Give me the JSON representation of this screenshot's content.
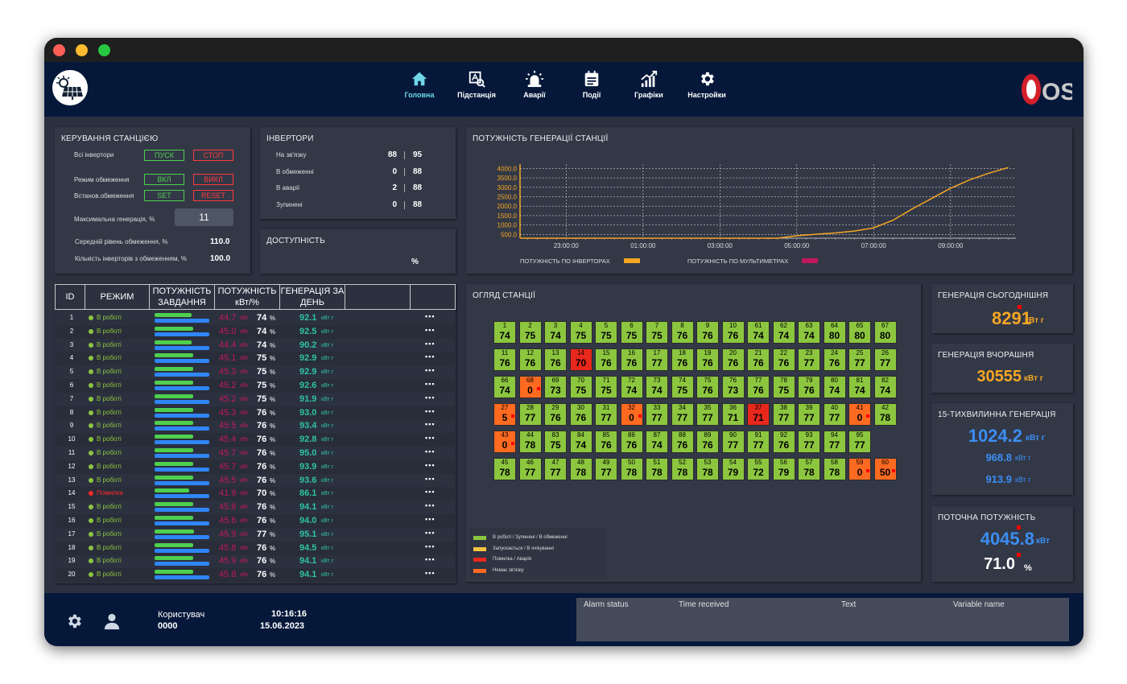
{
  "nav": [
    {
      "label": "Головна",
      "icon": "home-icon",
      "active": true
    },
    {
      "label": "Підстанція",
      "icon": "substation-icon",
      "active": false
    },
    {
      "label": "Аварії",
      "icon": "alarm-icon",
      "active": false
    },
    {
      "label": "Події",
      "icon": "events-icon",
      "active": false
    },
    {
      "label": "Графіки",
      "icon": "charts-icon",
      "active": false
    },
    {
      "label": "Настройки",
      "icon": "settings-icon",
      "active": false
    }
  ],
  "brand": "OSS",
  "control": {
    "title": "КЕРУВАННЯ СТАНЦІЄЮ",
    "all_inverters": "Всі інвертори",
    "start": "ПУСК",
    "stop": "СТОП",
    "limit_mode": "Режим обмеження",
    "on": "ВКЛ",
    "off": "ВИКЛ",
    "set_limit": "Встанов.обмеження",
    "set": "SET",
    "reset": "RESET",
    "max_gen": "Максимальна генерація, %",
    "max_gen_value": "11",
    "avg_limit": "Середній рівень обмеження, %",
    "avg_limit_value": "110.0",
    "count_limited": "Кількість інверторів з обмеженням, %",
    "count_limited_value": "100.0"
  },
  "inverters": {
    "title": "ІНВЕРТОРИ",
    "rows": [
      {
        "label": "На зв'язку",
        "a": "88",
        "b": "95"
      },
      {
        "label": "В обмеженні",
        "a": "0",
        "b": "88"
      },
      {
        "label": "В аварії",
        "a": "2",
        "b": "88"
      },
      {
        "label": "Зупинені",
        "a": "0",
        "b": "88"
      }
    ]
  },
  "availability": {
    "title": "ДОСТУПНІСТЬ",
    "unit": "%"
  },
  "chart_data": {
    "type": "line",
    "title": "ПОТУЖНІСТЬ ГЕНЕРАЦІЇ СТАНЦІЇ",
    "y_ticks": [
      "4000.0",
      "3500.0",
      "3000.0",
      "2500.0",
      "2000.0",
      "1500.0",
      "1000.0",
      "500.0"
    ],
    "x_ticks": [
      "23:00:00",
      "01:00:00",
      "03:00:00",
      "05:00:00",
      "07:00:00",
      "09:00:00"
    ],
    "ylim": [
      300,
      4100
    ],
    "x_hours": [
      21.8,
      22.5,
      23.5,
      24.5,
      25.5,
      26.5,
      27.5,
      28.5,
      29,
      29.5,
      30,
      30.5,
      31,
      31.5,
      32,
      32.5,
      33,
      33.5,
      34,
      34.5
    ],
    "series": [
      {
        "name": "ПОТУЖНІСТЬ ПО ІНВЕРТОРАХ",
        "color": "#f5a623",
        "values": [
          0,
          0,
          0,
          0,
          0,
          0,
          0,
          0,
          430,
          510,
          580,
          680,
          850,
          1250,
          1850,
          2400,
          2950,
          3400,
          3750,
          4050
        ]
      },
      {
        "name": "ПОТУЖНІСТЬ ПО МУЛЬТИМЕТРАХ",
        "color": "#c2185b",
        "values": []
      }
    ],
    "grid": true,
    "legend": "bottom"
  },
  "table": {
    "headers": [
      "ID",
      "РЕЖИМ",
      "ПОТУЖНІСТЬ ЗАВДАННЯ",
      "ПОТУЖНІСТЬ кВт/%",
      "ГЕНЕРАЦІЯ ЗА ДЕНЬ"
    ],
    "unit_kw": "кВт",
    "unit_pct": "%",
    "unit_kwh": "кВт г",
    "more": "▪▪▪",
    "rows": [
      {
        "id": "1",
        "status": "В роботі",
        "ok": true,
        "kw": "44.7",
        "pct": "74",
        "gen": "92.1",
        "bar_green": 0.68,
        "bar_blue": 1.0
      },
      {
        "id": "2",
        "status": "В роботі",
        "ok": true,
        "kw": "45.0",
        "pct": "74",
        "gen": "92.5",
        "bar_green": 0.7,
        "bar_blue": 1.0
      },
      {
        "id": "3",
        "status": "В роботі",
        "ok": true,
        "kw": "44.4",
        "pct": "74",
        "gen": "90.2",
        "bar_green": 0.68,
        "bar_blue": 1.0
      },
      {
        "id": "4",
        "status": "В роботі",
        "ok": true,
        "kw": "45.1",
        "pct": "75",
        "gen": "92.9",
        "bar_green": 0.7,
        "bar_blue": 1.0
      },
      {
        "id": "5",
        "status": "В роботі",
        "ok": true,
        "kw": "45.3",
        "pct": "75",
        "gen": "92.9",
        "bar_green": 0.7,
        "bar_blue": 1.0
      },
      {
        "id": "6",
        "status": "В роботі",
        "ok": true,
        "kw": "45.2",
        "pct": "75",
        "gen": "92.6",
        "bar_green": 0.7,
        "bar_blue": 1.0
      },
      {
        "id": "7",
        "status": "В роботі",
        "ok": true,
        "kw": "45.2",
        "pct": "75",
        "gen": "91.9",
        "bar_green": 0.7,
        "bar_blue": 1.0
      },
      {
        "id": "8",
        "status": "В роботі",
        "ok": true,
        "kw": "45.3",
        "pct": "76",
        "gen": "93.0",
        "bar_green": 0.7,
        "bar_blue": 1.0
      },
      {
        "id": "9",
        "status": "В роботі",
        "ok": true,
        "kw": "45.5",
        "pct": "76",
        "gen": "93.4",
        "bar_green": 0.71,
        "bar_blue": 1.0
      },
      {
        "id": "10",
        "status": "В роботі",
        "ok": true,
        "kw": "45.4",
        "pct": "76",
        "gen": "92.8",
        "bar_green": 0.71,
        "bar_blue": 1.0
      },
      {
        "id": "11",
        "status": "В роботі",
        "ok": true,
        "kw": "45.7",
        "pct": "76",
        "gen": "95.0",
        "bar_green": 0.71,
        "bar_blue": 1.0
      },
      {
        "id": "12",
        "status": "В роботі",
        "ok": true,
        "kw": "45.7",
        "pct": "76",
        "gen": "93.9",
        "bar_green": 0.71,
        "bar_blue": 1.0
      },
      {
        "id": "13",
        "status": "В роботі",
        "ok": true,
        "kw": "45.5",
        "pct": "76",
        "gen": "93.6",
        "bar_green": 0.71,
        "bar_blue": 1.0
      },
      {
        "id": "14",
        "status": "Помилка",
        "ok": false,
        "kw": "41.9",
        "pct": "70",
        "gen": "86.1",
        "bar_green": 0.63,
        "bar_blue": 1.0
      },
      {
        "id": "15",
        "status": "В роботі",
        "ok": true,
        "kw": "45.8",
        "pct": "76",
        "gen": "94.1",
        "bar_green": 0.71,
        "bar_blue": 1.0
      },
      {
        "id": "16",
        "status": "В роботі",
        "ok": true,
        "kw": "45.6",
        "pct": "76",
        "gen": "94.0",
        "bar_green": 0.71,
        "bar_blue": 1.0
      },
      {
        "id": "17",
        "status": "В роботі",
        "ok": true,
        "kw": "45.9",
        "pct": "77",
        "gen": "95.1",
        "bar_green": 0.72,
        "bar_blue": 1.0
      },
      {
        "id": "18",
        "status": "В роботі",
        "ok": true,
        "kw": "45.8",
        "pct": "76",
        "gen": "94.5",
        "bar_green": 0.71,
        "bar_blue": 1.0
      },
      {
        "id": "19",
        "status": "В роботі",
        "ok": true,
        "kw": "45.9",
        "pct": "76",
        "gen": "94.1",
        "bar_green": 0.71,
        "bar_blue": 1.0
      },
      {
        "id": "20",
        "status": "В роботі",
        "ok": true,
        "kw": "45.8",
        "pct": "76",
        "gen": "94.1",
        "bar_green": 0.71,
        "bar_blue": 1.0
      }
    ]
  },
  "overview": {
    "title": "ОГЛЯД СТАНЦІЇ",
    "rows": [
      [
        {
          "n": "1",
          "v": "74"
        },
        {
          "n": "2",
          "v": "75"
        },
        {
          "n": "3",
          "v": "74"
        },
        {
          "n": "4",
          "v": "75"
        },
        {
          "n": "5",
          "v": "75"
        },
        {
          "n": "6",
          "v": "75"
        },
        {
          "n": "7",
          "v": "75"
        },
        {
          "n": "8",
          "v": "76"
        },
        {
          "n": "9",
          "v": "76"
        },
        {
          "n": "10",
          "v": "76"
        },
        {
          "n": "61",
          "v": "74"
        },
        {
          "n": "62",
          "v": "74"
        },
        {
          "n": "63",
          "v": "74"
        },
        {
          "n": "64",
          "v": "80"
        },
        {
          "n": "65",
          "v": "80"
        },
        {
          "n": "67",
          "v": "80"
        }
      ],
      [
        {
          "n": "11",
          "v": "76"
        },
        {
          "n": "12",
          "v": "76"
        },
        {
          "n": "13",
          "v": "76"
        },
        {
          "n": "14",
          "v": "70",
          "s": "f"
        },
        {
          "n": "15",
          "v": "76"
        },
        {
          "n": "16",
          "v": "76"
        },
        {
          "n": "17",
          "v": "77"
        },
        {
          "n": "18",
          "v": "76"
        },
        {
          "n": "19",
          "v": "76"
        },
        {
          "n": "20",
          "v": "76"
        },
        {
          "n": "21",
          "v": "76"
        },
        {
          "n": "22",
          "v": "76"
        },
        {
          "n": "23",
          "v": "77"
        },
        {
          "n": "24",
          "v": "76"
        },
        {
          "n": "25",
          "v": "77"
        },
        {
          "n": "26",
          "v": "77"
        }
      ],
      [
        {
          "n": "66",
          "v": "74"
        },
        {
          "n": "68",
          "v": "0",
          "s": "e"
        },
        {
          "n": "69",
          "v": "73"
        },
        {
          "n": "70",
          "v": "75"
        },
        {
          "n": "71",
          "v": "75"
        },
        {
          "n": "72",
          "v": "74"
        },
        {
          "n": "73",
          "v": "74"
        },
        {
          "n": "74",
          "v": "75"
        },
        {
          "n": "75",
          "v": "76"
        },
        {
          "n": "76",
          "v": "73"
        },
        {
          "n": "77",
          "v": "76"
        },
        {
          "n": "78",
          "v": "75"
        },
        {
          "n": "79",
          "v": "76"
        },
        {
          "n": "80",
          "v": "74"
        },
        {
          "n": "81",
          "v": "74"
        },
        {
          "n": "82",
          "v": "74"
        }
      ],
      [
        {
          "n": "27",
          "v": "5",
          "s": "e"
        },
        {
          "n": "28",
          "v": "77"
        },
        {
          "n": "29",
          "v": "76"
        },
        {
          "n": "30",
          "v": "76"
        },
        {
          "n": "31",
          "v": "77"
        },
        {
          "n": "32",
          "v": "0",
          "s": "e"
        },
        {
          "n": "33",
          "v": "77"
        },
        {
          "n": "34",
          "v": "77"
        },
        {
          "n": "35",
          "v": "77"
        },
        {
          "n": "36",
          "v": "71"
        },
        {
          "n": "37",
          "v": "71",
          "s": "f"
        },
        {
          "n": "38",
          "v": "77"
        },
        {
          "n": "39",
          "v": "77"
        },
        {
          "n": "40",
          "v": "77"
        },
        {
          "n": "41",
          "v": "0",
          "s": "e"
        },
        {
          "n": "42",
          "v": "78"
        }
      ],
      [
        {
          "n": "43",
          "v": "0",
          "s": "e"
        },
        {
          "n": "44",
          "v": "78"
        },
        {
          "n": "83",
          "v": "75"
        },
        {
          "n": "84",
          "v": "74"
        },
        {
          "n": "85",
          "v": "76"
        },
        {
          "n": "86",
          "v": "76"
        },
        {
          "n": "87",
          "v": "74"
        },
        {
          "n": "88",
          "v": "76"
        },
        {
          "n": "89",
          "v": "76"
        },
        {
          "n": "90",
          "v": "77"
        },
        {
          "n": "91",
          "v": "77"
        },
        {
          "n": "92",
          "v": "76"
        },
        {
          "n": "93",
          "v": "77"
        },
        {
          "n": "94",
          "v": "77"
        },
        {
          "n": "95",
          "v": "77"
        }
      ],
      [
        {
          "n": "45",
          "v": "78"
        },
        {
          "n": "46",
          "v": "77"
        },
        {
          "n": "47",
          "v": "77"
        },
        {
          "n": "48",
          "v": "78"
        },
        {
          "n": "49",
          "v": "77"
        },
        {
          "n": "50",
          "v": "78"
        },
        {
          "n": "51",
          "v": "78"
        },
        {
          "n": "52",
          "v": "78"
        },
        {
          "n": "53",
          "v": "78"
        },
        {
          "n": "54",
          "v": "79"
        },
        {
          "n": "55",
          "v": "72"
        },
        {
          "n": "56",
          "v": "79"
        },
        {
          "n": "57",
          "v": "78"
        },
        {
          "n": "58",
          "v": "78"
        },
        {
          "n": "59",
          "v": "0",
          "s": "e"
        },
        {
          "n": "60",
          "v": "50",
          "s": "e"
        }
      ]
    ],
    "legend": [
      {
        "label": "В роботі / Зупинені / В обмеженні",
        "color": "#8cc63f"
      },
      {
        "label": "Запускається / В очікуванні",
        "color": "#f5c242"
      },
      {
        "label": "Помилка / Аварія",
        "color": "#e8281c"
      },
      {
        "label": "Немає зв'язку",
        "color": "#ff6a21"
      }
    ]
  },
  "kpi": {
    "today": {
      "title": "ГЕНЕРАЦІЯ СЬОГОДНІШНЯ",
      "value": "8291",
      "unit": "кВт г"
    },
    "yesterday": {
      "title": "ГЕНЕРАЦІЯ ВЧОРАШНЯ",
      "value": "30555",
      "unit": "кВт г"
    },
    "min15": {
      "title": "15-ТИХВИЛИННА ГЕНЕРАЦІЯ",
      "value": "1024.2",
      "unit": "кВт г",
      "v2": "968.8",
      "v3": "913.9",
      "unit_small": "кВт г"
    },
    "current": {
      "title": "ПОТОЧНА ПОТУЖНІСТЬ",
      "value": "4045.8",
      "unit": "кВт",
      "pct": "71.0",
      "pct_unit": "%"
    }
  },
  "footer": {
    "user_label": "Користувач",
    "user_id": "0000",
    "time": "10:16:16",
    "date": "15.06.2023",
    "alarm_headers": [
      "Alarm status",
      "Time received",
      "Text",
      "Variable name"
    ]
  }
}
